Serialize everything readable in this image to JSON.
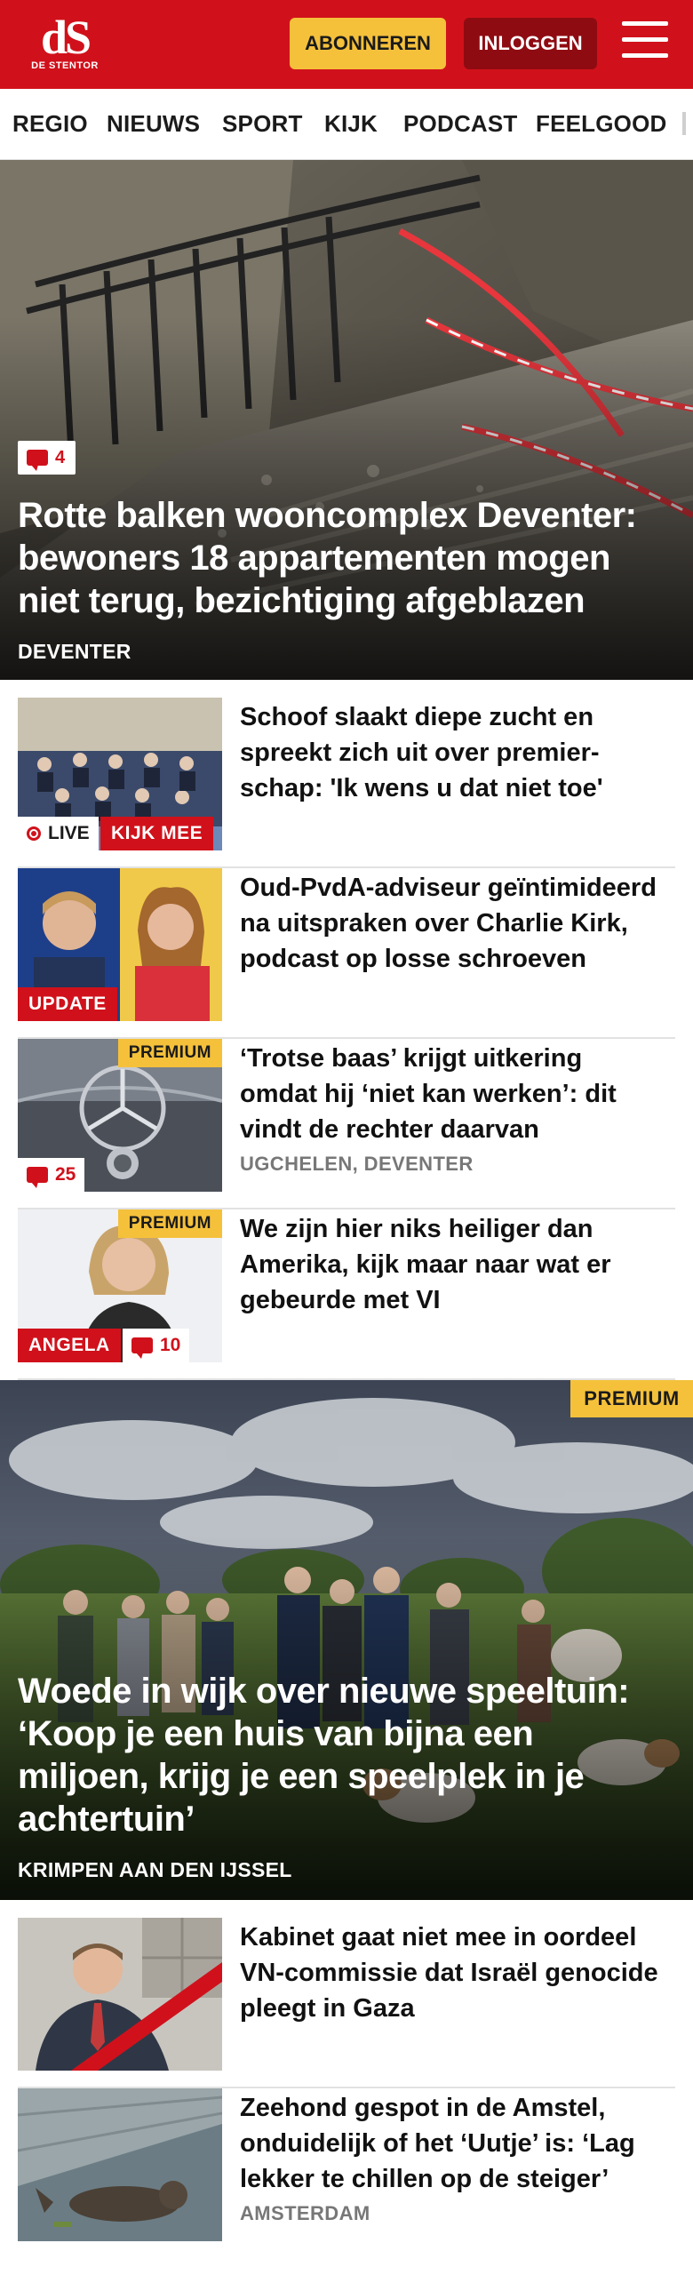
{
  "header": {
    "logo_mark": "dS",
    "logo_name": "DE STENTOR",
    "subscribe_label": "ABONNEREN",
    "login_label": "INLOGGEN"
  },
  "nav": {
    "items": [
      "REGIO",
      "NIEUWS",
      "SPORT",
      "KIJK",
      "PODCAST",
      "FEELGOOD"
    ]
  },
  "hero1": {
    "comment_count": "4",
    "title": "Rotte balken wooncomplex Deventer: bewoners 18 appartementen mogen niet terug, bezichtiging afgeblazen",
    "kicker": "DEVENTER"
  },
  "articles": [
    {
      "title": "Schoof slaakt diepe zucht en spreekt zich uit over premier­schap: 'Ik wens u dat niet toe'",
      "live_label": "LIVE",
      "watch_label": "KIJK MEE"
    },
    {
      "title": "Oud-PvdA-adviseur geïntimi­deerd na uitspraken over Charlie Kirk, podcast op losse schroeven",
      "update_label": "UPDATE"
    },
    {
      "title": "‘Trotse baas’ krijgt uitkering omdat hij ‘niet kan werken’: dit vindt de rechter daarvan",
      "kicker": "UGCHELEN, DEVENTER",
      "premium_label": "PREMIUM",
      "comment_count": "25"
    },
    {
      "title": "We zijn hier niks heiliger dan Amerika, kijk maar naar wat er gebeurde met VI",
      "premium_label": "PREMIUM",
      "author_label": "ANGELA",
      "comment_count": "10"
    }
  ],
  "hero2": {
    "premium_label": "PREMIUM",
    "title": "Woede in wijk over nieuwe speeltuin: ‘Koop je een huis van bijna een miljoen, krijg je een speelplek in je achtertuin’",
    "kicker": "KRIMPEN AAN DEN IJSSEL"
  },
  "articles2": [
    {
      "title": "Kabinet gaat niet mee in oordeel VN-commissie dat Israël genocide pleegt in Gaza"
    },
    {
      "title": "Zeehond gespot in de Amstel, onduidelijk of het ‘Uutje’ is: ‘Lag lekker te chillen op de steiger’",
      "kicker": "AMSTERDAM"
    }
  ],
  "colors": {
    "brand_red": "#d0111b",
    "premium_yellow": "#f5c13b",
    "login_dark_red": "#8f0b12"
  }
}
